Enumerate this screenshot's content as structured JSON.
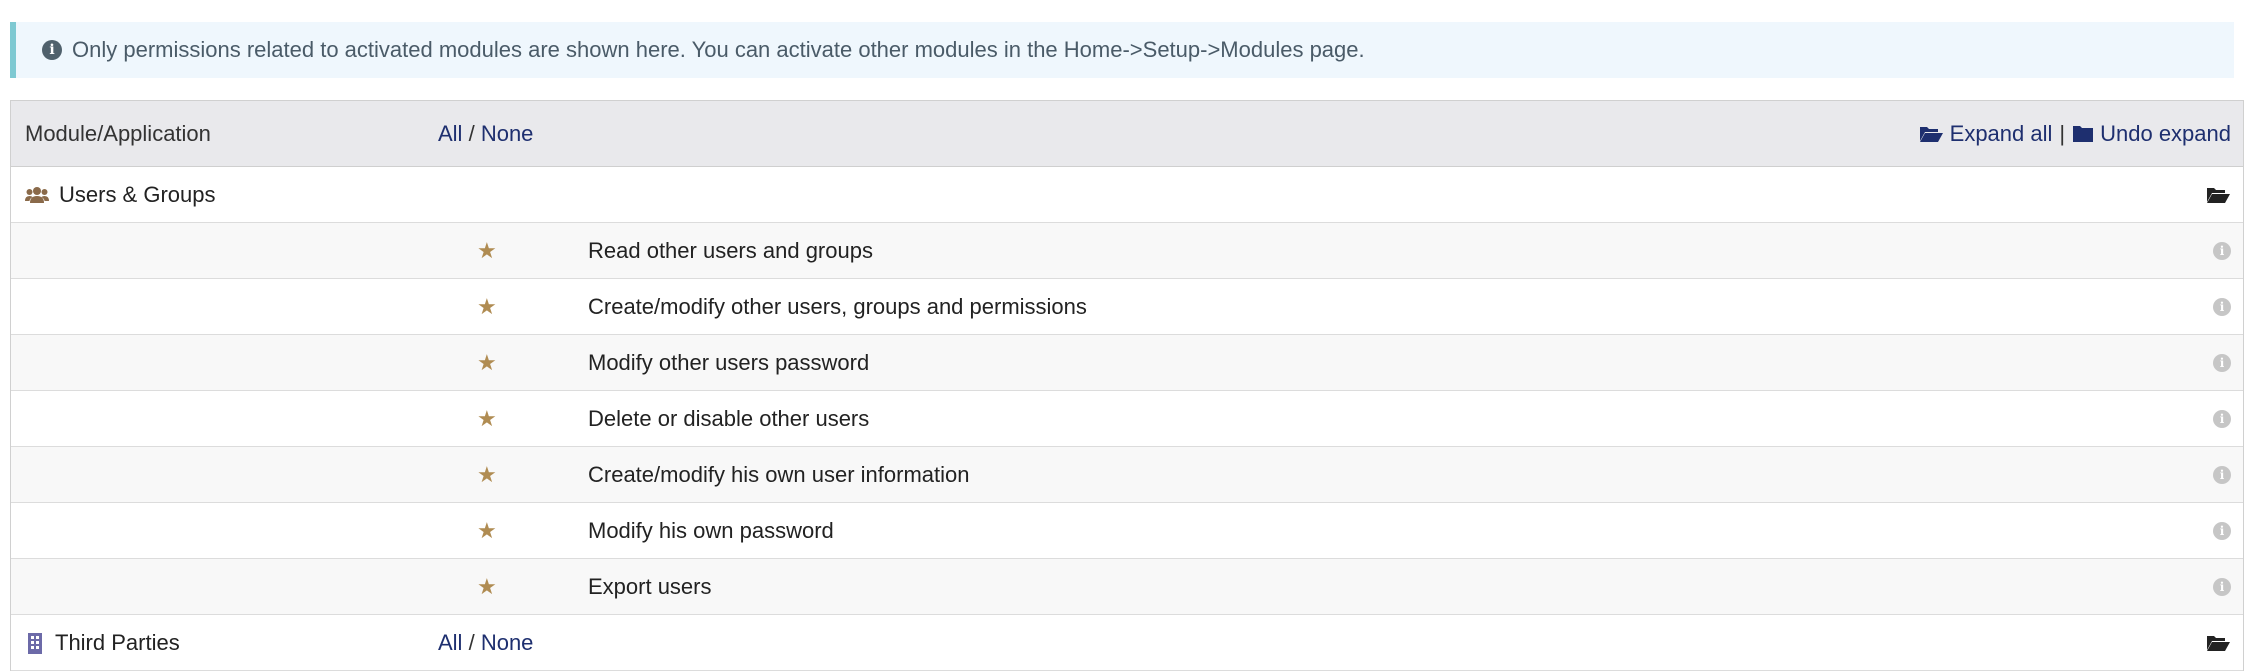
{
  "notice": {
    "icon": "info-circle-icon",
    "text": "Only permissions related to activated modules are shown here. You can activate other modules in the Home->Setup->Modules page."
  },
  "header": {
    "module_label": "Module/Application",
    "all_label": "All",
    "slash": "/",
    "none_label": "None",
    "expand_all_label": "Expand all",
    "separator": "|",
    "undo_expand_label": "Undo expand"
  },
  "modules": [
    {
      "name": "Users & Groups",
      "icon": "users-icon",
      "permissions": [
        "Read other users and groups",
        "Create/modify other users, groups and permissions",
        "Modify other users password",
        "Delete or disable other users",
        "Create/modify his own user information",
        "Modify his own password",
        "Export users"
      ]
    },
    {
      "name": "Third Parties",
      "icon": "building-icon",
      "all_label": "All",
      "slash": "/",
      "none_label": "None"
    }
  ],
  "colors": {
    "link": "#1e2f6f",
    "star": "#b08c52",
    "notice_bg": "#eff7fd",
    "notice_border": "#7ec9d2",
    "header_bg": "#e9e9ec"
  }
}
